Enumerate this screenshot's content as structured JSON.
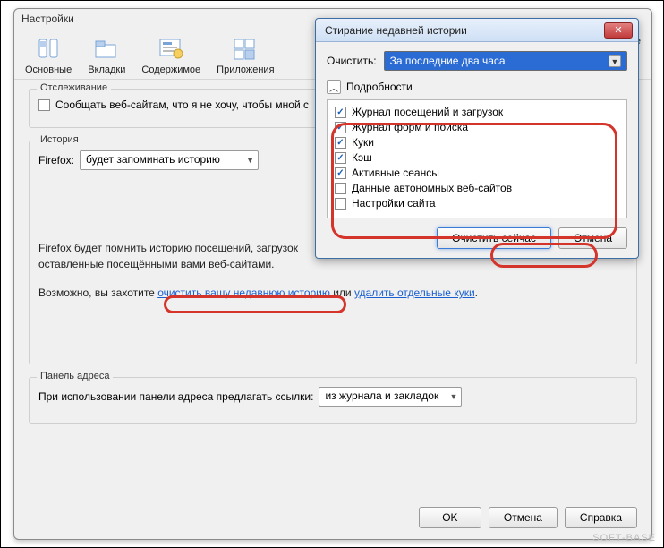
{
  "main": {
    "title": "Настройки",
    "toolbar": [
      {
        "label": "Основные"
      },
      {
        "label": "Вкладки"
      },
      {
        "label": "Содержимое"
      },
      {
        "label": "Приложения"
      },
      {
        "label": "ые"
      }
    ],
    "tracking": {
      "legend": "Отслеживание",
      "option": "Сообщать веб-сайтам, что я не хочу, чтобы мной с"
    },
    "history": {
      "legend": "История",
      "firefox_label": "Firefox:",
      "mode": "будет запоминать историю",
      "desc_line1": "Firefox будет помнить историю посещений, загрузок",
      "desc_line2": "оставленные посещёнными вами веб-сайтами.",
      "maybe": "Возможно, вы захотите ",
      "link1": "очистить вашу недавнюю историю",
      "or": " или ",
      "link2": "удалить отдельные куки",
      "dot": "."
    },
    "addressbar": {
      "legend": "Панель адреса",
      "label": "При использовании панели адреса предлагать ссылки:",
      "value": "из журнала и закладок"
    },
    "buttons": {
      "ok": "OK",
      "cancel": "Отмена",
      "help": "Справка"
    }
  },
  "dialog": {
    "title": "Стирание недавней истории",
    "clear_label": "Очистить:",
    "range": "За последние два часа",
    "details_label": "Подробности",
    "items": [
      {
        "label": "Журнал посещений и загрузок",
        "checked": true
      },
      {
        "label": "Журнал форм и поиска",
        "checked": true
      },
      {
        "label": "Куки",
        "checked": true
      },
      {
        "label": "Кэш",
        "checked": true
      },
      {
        "label": "Активные сеансы",
        "checked": true
      },
      {
        "label": "Данные автономных веб-сайтов",
        "checked": false
      },
      {
        "label": "Настройки сайта",
        "checked": false
      }
    ],
    "buttons": {
      "clear_now": "Очистить сейчас",
      "cancel": "Отмена"
    }
  },
  "watermark": "SOFT-BASE"
}
